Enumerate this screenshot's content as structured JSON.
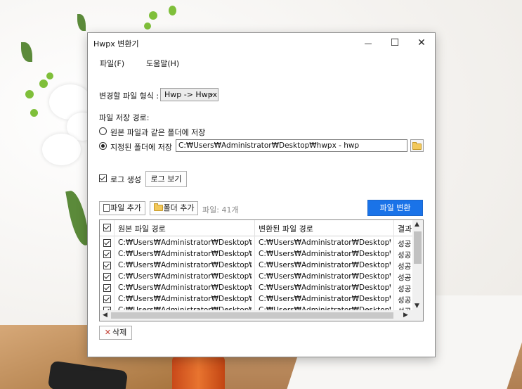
{
  "window": {
    "title": "Hwpx 변환기",
    "controls": {
      "minimize": "—",
      "maximize": "☐",
      "close": "✕"
    }
  },
  "menu": {
    "file": "파일(F)",
    "help": "도움말(H)"
  },
  "format": {
    "label": "변경할 파일 형식 :",
    "value": "Hwp -> Hwpx",
    "arrow": "⌄"
  },
  "save_path": {
    "label": "파일 저장 경로:",
    "option_same_folder": "원본 파일과 같은 폴더에 저장",
    "option_custom_folder": "지정된 폴더에 저장",
    "selected": "custom",
    "path_value": "C:₩Users₩Administrator₩Desktop₩hwpx - hwp"
  },
  "log": {
    "checkbox_label": "로그 생성",
    "checked": true,
    "view_button": "로그 보기"
  },
  "toolbar": {
    "add_file": "파일 추가",
    "add_folder": "폴더 추가",
    "file_count": "파일: 41개",
    "convert": "파일 변환"
  },
  "table": {
    "headers": [
      "원본 파일 경로",
      "변환된 파일 경로",
      "결과"
    ],
    "rows": [
      {
        "source": "C:₩Users₩Administrator₩Desktop₩hw...",
        "target": "C:₩Users₩Administrator₩Desktop₩hw...",
        "result": "성공"
      },
      {
        "source": "C:₩Users₩Administrator₩Desktop₩hw...",
        "target": "C:₩Users₩Administrator₩Desktop₩hw...",
        "result": "성공"
      },
      {
        "source": "C:₩Users₩Administrator₩Desktop₩hw...",
        "target": "C:₩Users₩Administrator₩Desktop₩hw...",
        "result": "성공"
      },
      {
        "source": "C:₩Users₩Administrator₩Desktop₩hw...",
        "target": "C:₩Users₩Administrator₩Desktop₩hw...",
        "result": "성공"
      },
      {
        "source": "C:₩Users₩Administrator₩Desktop₩hw...",
        "target": "C:₩Users₩Administrator₩Desktop₩hw...",
        "result": "성공"
      },
      {
        "source": "C:₩Users₩Administrator₩Desktop₩hw...",
        "target": "C:₩Users₩Administrator₩Desktop₩hw...",
        "result": "성공"
      },
      {
        "source": "C:₩Users₩Administrator₩Desktop₩hw...",
        "target": "C:₩Users₩Administrator₩Desktop₩hw...",
        "result": "성공"
      }
    ]
  },
  "delete_button": "삭제",
  "colors": {
    "accent": "#1a73e8",
    "accent_text": "#ffffff",
    "delete_icon": "#c0392b"
  }
}
